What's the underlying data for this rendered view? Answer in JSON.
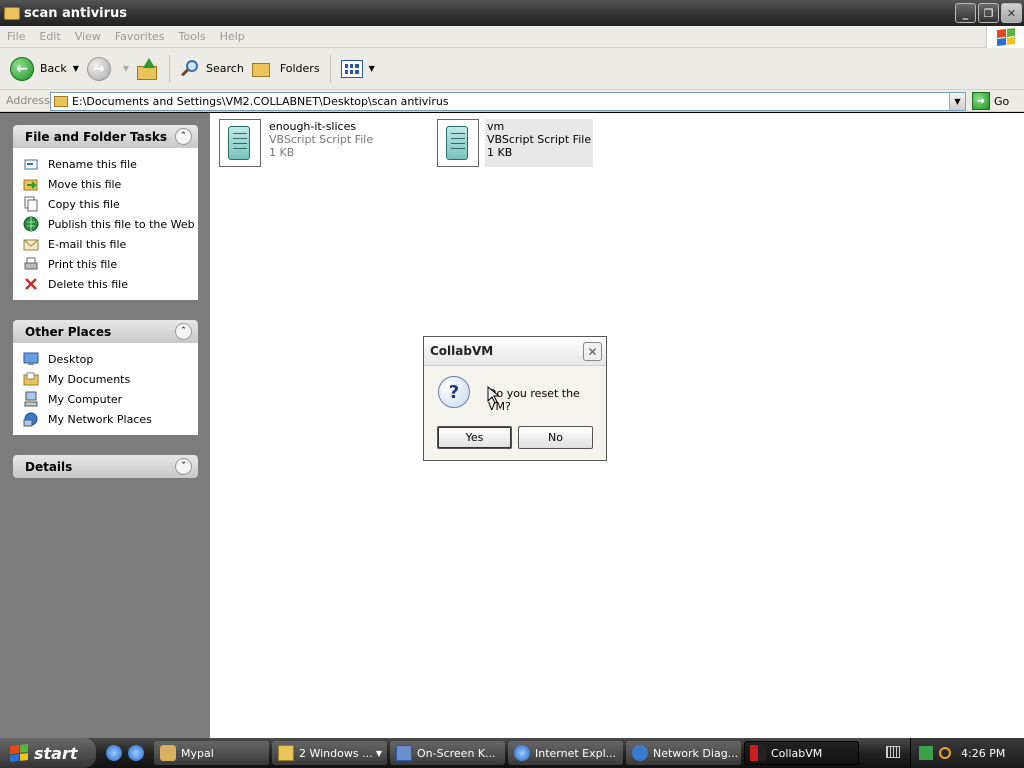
{
  "window": {
    "title": "scan antivirus",
    "buttons": [
      "_",
      "❐",
      "✕"
    ]
  },
  "menu": [
    "File",
    "Edit",
    "View",
    "Favorites",
    "Tools",
    "Help"
  ],
  "toolbar": {
    "back": "Back",
    "search": "Search",
    "folders": "Folders"
  },
  "address": {
    "label": "Address",
    "value": "E:\\Documents and Settings\\VM2.COLLABNET\\Desktop\\scan antivirus",
    "go": "Go"
  },
  "tasks_panel": {
    "title": "File and Folder Tasks",
    "items": [
      {
        "label": "Rename this file",
        "icon": "rename-icon"
      },
      {
        "label": "Move this file",
        "icon": "move-icon"
      },
      {
        "label": "Copy this file",
        "icon": "copy-icon"
      },
      {
        "label": "Publish this file to the Web",
        "icon": "publish-icon"
      },
      {
        "label": "E-mail this file",
        "icon": "email-icon"
      },
      {
        "label": "Print this file",
        "icon": "print-icon"
      },
      {
        "label": "Delete this file",
        "icon": "delete-icon"
      }
    ]
  },
  "places_panel": {
    "title": "Other Places",
    "items": [
      {
        "label": "Desktop",
        "icon": "desktop-icon"
      },
      {
        "label": "My Documents",
        "icon": "my-documents-icon"
      },
      {
        "label": "My Computer",
        "icon": "my-computer-icon"
      },
      {
        "label": "My Network Places",
        "icon": "network-places-icon"
      }
    ]
  },
  "details_panel": {
    "title": "Details"
  },
  "files": [
    {
      "name": "enough-it-slices",
      "type": "VBScript Script File",
      "size": "1 KB"
    },
    {
      "name": "vm",
      "type": "VBScript Script File",
      "size": "1 KB"
    }
  ],
  "dialog": {
    "title": "CollabVM",
    "message": "Do you reset the VM?",
    "yes": "Yes",
    "no": "No"
  },
  "taskbar": {
    "start": "start",
    "tasks": [
      {
        "label": "Mypal"
      },
      {
        "label": "2 Windows ..."
      },
      {
        "label": "On-Screen K..."
      },
      {
        "label": "Internet Expl..."
      },
      {
        "label": "Network Diag..."
      },
      {
        "label": "CollabVM"
      }
    ],
    "clock": "4:26 PM"
  },
  "colors": {
    "left_pane": "#7c7c7c",
    "title_bar": "#3a3a3a",
    "taskbar": "#222222"
  }
}
